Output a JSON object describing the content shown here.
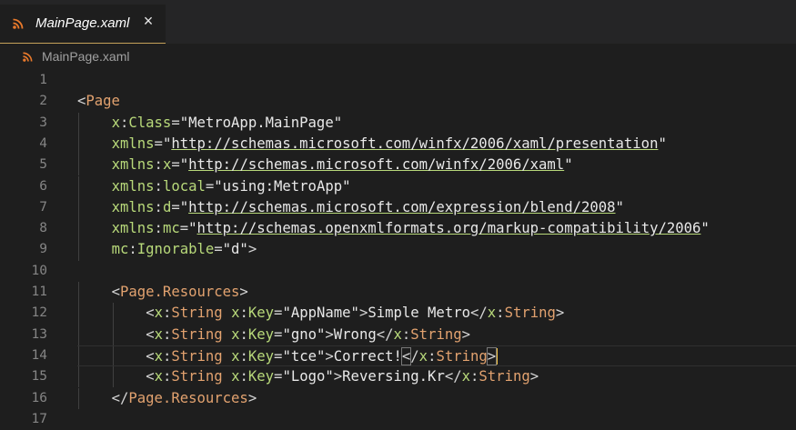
{
  "tab": {
    "label": "MainPage.xaml",
    "close": "×",
    "icon": "rss-icon"
  },
  "breadcrumb": {
    "label": "MainPage.xaml",
    "icon": "rss-icon"
  },
  "colors": {
    "tab_underline": "#c5a15a",
    "icon": "#e8792b",
    "tag": "#e2a26f",
    "attr": "#b8d97a",
    "string": "#e8e8e8",
    "line_number": "#858585"
  },
  "lines": [
    {
      "num": "1",
      "tokens": []
    },
    {
      "num": "2",
      "tokens": [
        {
          "t": "<",
          "c": "k-eq"
        },
        {
          "t": "Page",
          "c": "k-tag"
        }
      ]
    },
    {
      "num": "3",
      "tokens": [
        {
          "t": "x",
          "c": "k-attr"
        },
        {
          "t": ":",
          "c": "k-eq"
        },
        {
          "t": "Class",
          "c": "k-attr"
        },
        {
          "t": "=",
          "c": "k-eq"
        },
        {
          "t": "\"MetroApp.MainPage\"",
          "c": "k-str"
        }
      ]
    },
    {
      "num": "4",
      "tokens": [
        {
          "t": "xmlns",
          "c": "k-attr"
        },
        {
          "t": "=",
          "c": "k-eq"
        },
        {
          "t": "\"",
          "c": "k-str"
        },
        {
          "t": "http://schemas.microsoft.com/winfx/2006/xaml/presentation",
          "c": "k-str",
          "u": true
        },
        {
          "t": "\"",
          "c": "k-str"
        }
      ]
    },
    {
      "num": "5",
      "tokens": [
        {
          "t": "xmlns",
          "c": "k-attr"
        },
        {
          "t": ":",
          "c": "k-eq"
        },
        {
          "t": "x",
          "c": "k-attr"
        },
        {
          "t": "=",
          "c": "k-eq"
        },
        {
          "t": "\"",
          "c": "k-str"
        },
        {
          "t": "http://schemas.microsoft.com/winfx/2006/xaml",
          "c": "k-str",
          "u": true
        },
        {
          "t": "\"",
          "c": "k-str"
        }
      ]
    },
    {
      "num": "6",
      "tokens": [
        {
          "t": "xmlns",
          "c": "k-attr"
        },
        {
          "t": ":",
          "c": "k-eq"
        },
        {
          "t": "local",
          "c": "k-attr"
        },
        {
          "t": "=",
          "c": "k-eq"
        },
        {
          "t": "\"using:MetroApp\"",
          "c": "k-str"
        }
      ]
    },
    {
      "num": "7",
      "tokens": [
        {
          "t": "xmlns",
          "c": "k-attr"
        },
        {
          "t": ":",
          "c": "k-eq"
        },
        {
          "t": "d",
          "c": "k-attr"
        },
        {
          "t": "=",
          "c": "k-eq"
        },
        {
          "t": "\"",
          "c": "k-str"
        },
        {
          "t": "http://schemas.microsoft.com/expression/blend/2008",
          "c": "k-str",
          "u": true
        },
        {
          "t": "\"",
          "c": "k-str"
        }
      ]
    },
    {
      "num": "8",
      "tokens": [
        {
          "t": "xmlns",
          "c": "k-attr"
        },
        {
          "t": ":",
          "c": "k-eq"
        },
        {
          "t": "mc",
          "c": "k-attr"
        },
        {
          "t": "=",
          "c": "k-eq"
        },
        {
          "t": "\"",
          "c": "k-str"
        },
        {
          "t": "http://schemas.openxmlformats.org/markup-compatibility/2006",
          "c": "k-str",
          "u": true
        },
        {
          "t": "\"",
          "c": "k-str"
        }
      ]
    },
    {
      "num": "9",
      "tokens": [
        {
          "t": "mc",
          "c": "k-attr"
        },
        {
          "t": ":",
          "c": "k-eq"
        },
        {
          "t": "Ignorable",
          "c": "k-attr"
        },
        {
          "t": "=",
          "c": "k-eq"
        },
        {
          "t": "\"d\"",
          "c": "k-str"
        },
        {
          "t": ">",
          "c": "k-eq"
        }
      ]
    },
    {
      "num": "10",
      "tokens": []
    },
    {
      "num": "11",
      "tokens": [
        {
          "t": "<",
          "c": "k-eq"
        },
        {
          "t": "Page.Resources",
          "c": "k-tag"
        },
        {
          "t": ">",
          "c": "k-eq"
        }
      ]
    },
    {
      "num": "12",
      "tokens": [
        {
          "t": "<",
          "c": "k-eq"
        },
        {
          "t": "x",
          "c": "k-ns"
        },
        {
          "t": ":",
          "c": "k-eq"
        },
        {
          "t": "String",
          "c": "k-tag"
        },
        {
          "t": " ",
          "c": "k-eq"
        },
        {
          "t": "x",
          "c": "k-attr"
        },
        {
          "t": ":",
          "c": "k-eq"
        },
        {
          "t": "Key",
          "c": "k-attr"
        },
        {
          "t": "=",
          "c": "k-eq"
        },
        {
          "t": "\"AppName\"",
          "c": "k-str"
        },
        {
          "t": ">",
          "c": "k-eq"
        },
        {
          "t": "Simple Metro",
          "c": "k-str"
        },
        {
          "t": "</",
          "c": "k-eq"
        },
        {
          "t": "x",
          "c": "k-ns"
        },
        {
          "t": ":",
          "c": "k-eq"
        },
        {
          "t": "String",
          "c": "k-tag"
        },
        {
          "t": ">",
          "c": "k-eq"
        }
      ]
    },
    {
      "num": "13",
      "tokens": [
        {
          "t": "<",
          "c": "k-eq"
        },
        {
          "t": "x",
          "c": "k-ns"
        },
        {
          "t": ":",
          "c": "k-eq"
        },
        {
          "t": "String",
          "c": "k-tag"
        },
        {
          "t": " ",
          "c": "k-eq"
        },
        {
          "t": "x",
          "c": "k-attr"
        },
        {
          "t": ":",
          "c": "k-eq"
        },
        {
          "t": "Key",
          "c": "k-attr"
        },
        {
          "t": "=",
          "c": "k-eq"
        },
        {
          "t": "\"gno\"",
          "c": "k-str"
        },
        {
          "t": ">",
          "c": "k-eq"
        },
        {
          "t": "Wrong",
          "c": "k-str"
        },
        {
          "t": "</",
          "c": "k-eq"
        },
        {
          "t": "x",
          "c": "k-ns"
        },
        {
          "t": ":",
          "c": "k-eq"
        },
        {
          "t": "String",
          "c": "k-tag"
        },
        {
          "t": ">",
          "c": "k-eq"
        }
      ]
    },
    {
      "num": "14",
      "current": true,
      "tokens": [
        {
          "t": "<",
          "c": "k-eq"
        },
        {
          "t": "x",
          "c": "k-ns"
        },
        {
          "t": ":",
          "c": "k-eq"
        },
        {
          "t": "String",
          "c": "k-tag"
        },
        {
          "t": " ",
          "c": "k-eq"
        },
        {
          "t": "x",
          "c": "k-attr"
        },
        {
          "t": ":",
          "c": "k-eq"
        },
        {
          "t": "Key",
          "c": "k-attr"
        },
        {
          "t": "=",
          "c": "k-eq"
        },
        {
          "t": "\"tce\"",
          "c": "k-str"
        },
        {
          "t": ">",
          "c": "k-eq"
        },
        {
          "t": "Correct!",
          "c": "k-str"
        },
        {
          "t": "<",
          "c": "k-eq",
          "m": true
        },
        {
          "t": "/",
          "c": "k-eq"
        },
        {
          "t": "x",
          "c": "k-ns"
        },
        {
          "t": ":",
          "c": "k-eq"
        },
        {
          "t": "String",
          "c": "k-tag"
        },
        {
          "t": ">",
          "c": "k-eq",
          "m": true,
          "cursor": true
        }
      ]
    },
    {
      "num": "15",
      "tokens": [
        {
          "t": "<",
          "c": "k-eq"
        },
        {
          "t": "x",
          "c": "k-ns"
        },
        {
          "t": ":",
          "c": "k-eq"
        },
        {
          "t": "String",
          "c": "k-tag"
        },
        {
          "t": " ",
          "c": "k-eq"
        },
        {
          "t": "x",
          "c": "k-attr"
        },
        {
          "t": ":",
          "c": "k-eq"
        },
        {
          "t": "Key",
          "c": "k-attr"
        },
        {
          "t": "=",
          "c": "k-eq"
        },
        {
          "t": "\"Logo\"",
          "c": "k-str"
        },
        {
          "t": ">",
          "c": "k-eq"
        },
        {
          "t": "Reversing.Kr",
          "c": "k-str"
        },
        {
          "t": "</",
          "c": "k-eq"
        },
        {
          "t": "x",
          "c": "k-ns"
        },
        {
          "t": ":",
          "c": "k-eq"
        },
        {
          "t": "String",
          "c": "k-tag"
        },
        {
          "t": ">",
          "c": "k-eq"
        }
      ]
    },
    {
      "num": "16",
      "tokens": [
        {
          "t": "</",
          "c": "k-eq"
        },
        {
          "t": "Page.Resources",
          "c": "k-tag"
        },
        {
          "t": ">",
          "c": "k-eq"
        }
      ]
    },
    {
      "num": "17",
      "tokens": []
    }
  ]
}
